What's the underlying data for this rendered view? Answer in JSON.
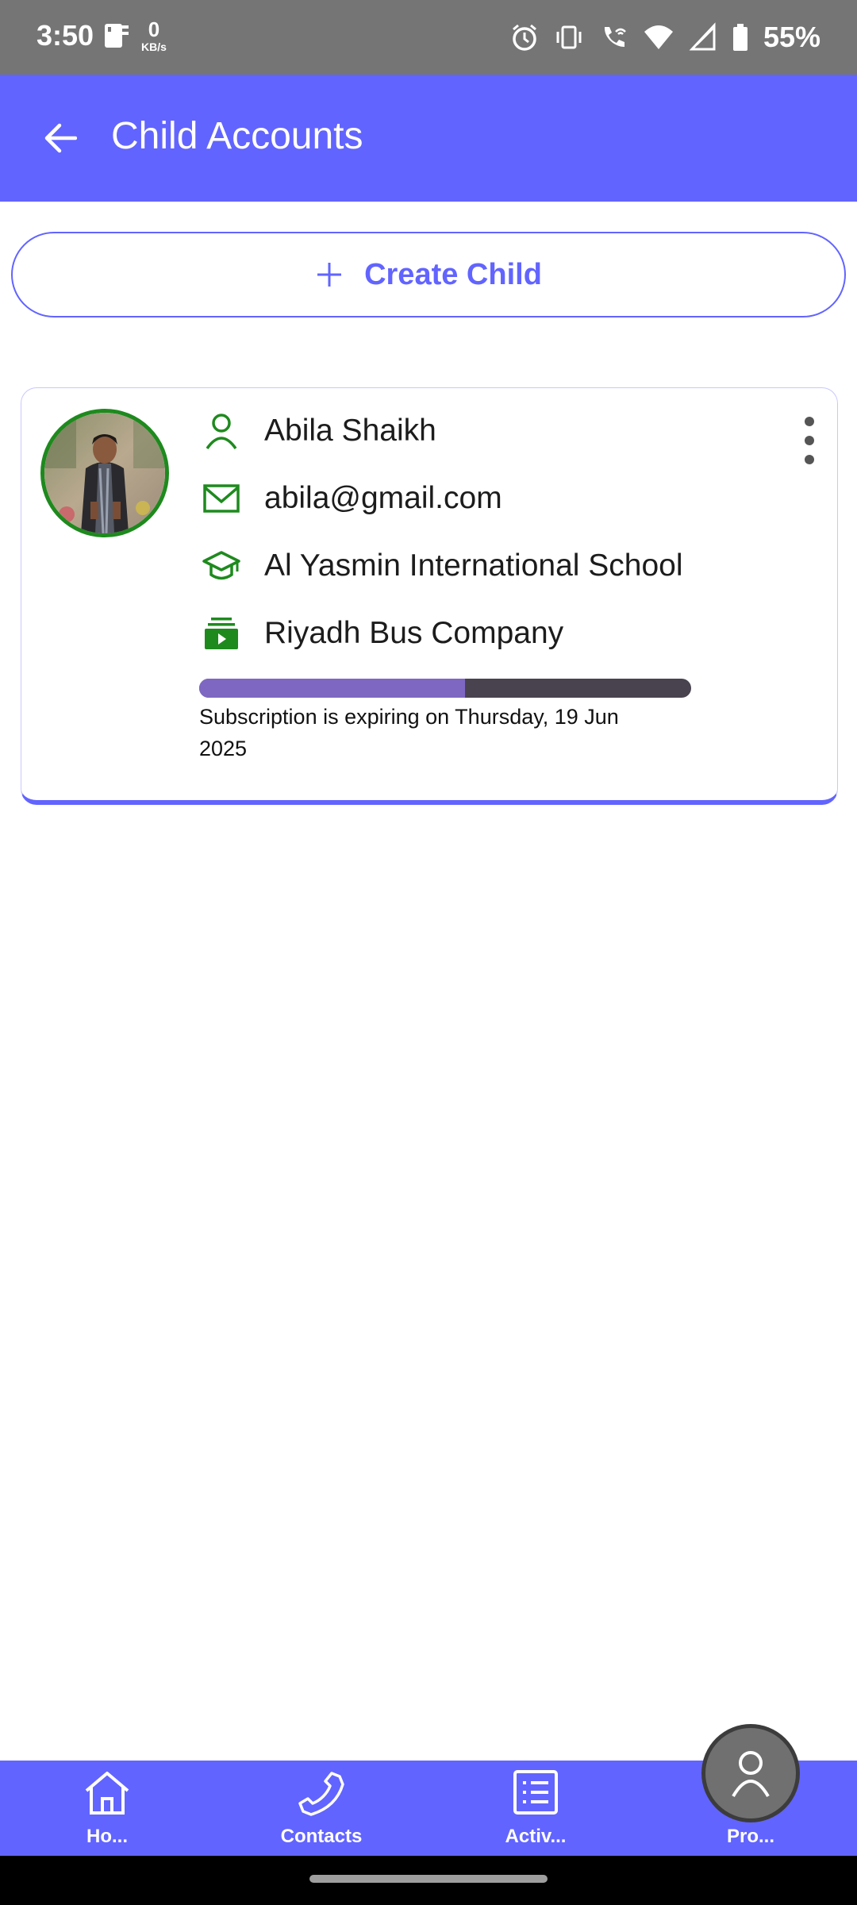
{
  "status_bar": {
    "time": "3:50",
    "net_speed_value": "0",
    "net_speed_unit": "KB/s",
    "battery": "55%",
    "icons": [
      "sim-icon",
      "alarm-icon",
      "vibrate-icon",
      "wifi-call-icon",
      "wifi-icon",
      "signal-icon",
      "battery-icon"
    ]
  },
  "app_bar": {
    "title": "Child Accounts",
    "back_icon": "arrow-left-icon",
    "color": "#6264ff"
  },
  "create_button": {
    "label": "Create Child",
    "icon": "plus-icon"
  },
  "children": [
    {
      "name": "Abila Shaikh",
      "email": "abila@gmail.com",
      "school": "Al Yasmin International School",
      "bus_company": "Riyadh Bus Company",
      "subscription_text": "Subscription is expiring on Thursday, 19 Jun 2025",
      "subscription_progress": 0.54,
      "icons": [
        "person-icon",
        "mail-icon",
        "graduation-cap-icon",
        "bus-ticket-icon"
      ],
      "accent_color": "#1e8a1e"
    }
  ],
  "bottom_nav": {
    "items": [
      {
        "label": "Ho...",
        "icon": "home-icon"
      },
      {
        "label": "Contacts",
        "icon": "phone-icon"
      },
      {
        "label": "Activ...",
        "icon": "list-icon"
      },
      {
        "label": "Pro...",
        "icon": "profile-icon"
      }
    ]
  }
}
